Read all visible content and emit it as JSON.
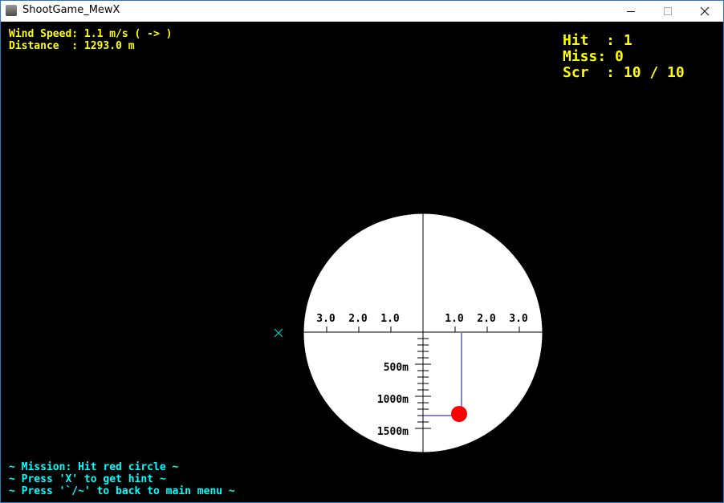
{
  "window": {
    "title": "ShootGame_MewX",
    "icon": "app-icon"
  },
  "hud": {
    "wind_speed": "Wind Speed: 1.1 m/s ( -> )",
    "distance": "Distance  : 1293.0 m",
    "hit": "Hit  : 1",
    "miss": "Miss: 0",
    "score": "Scr  : 10 / 10"
  },
  "scope": {
    "left_ticks": [
      "3.0",
      "2.0",
      "1.0"
    ],
    "right_ticks": [
      "1.0",
      "2.0",
      "3.0"
    ],
    "range_labels": [
      "500m",
      "1000m",
      "1500m"
    ],
    "hint_marker": "x-icon",
    "target": "red-circle-target",
    "colors": {
      "target": "#ff0000",
      "guide": "#0000cc",
      "hint": "#00cccc",
      "scope_bg": "#ffffff"
    }
  },
  "messages": [
    "~ Mission: Hit red circle ~",
    "~ Press 'X' to get hint ~",
    "~ Press '`/~' to back to main menu ~"
  ]
}
